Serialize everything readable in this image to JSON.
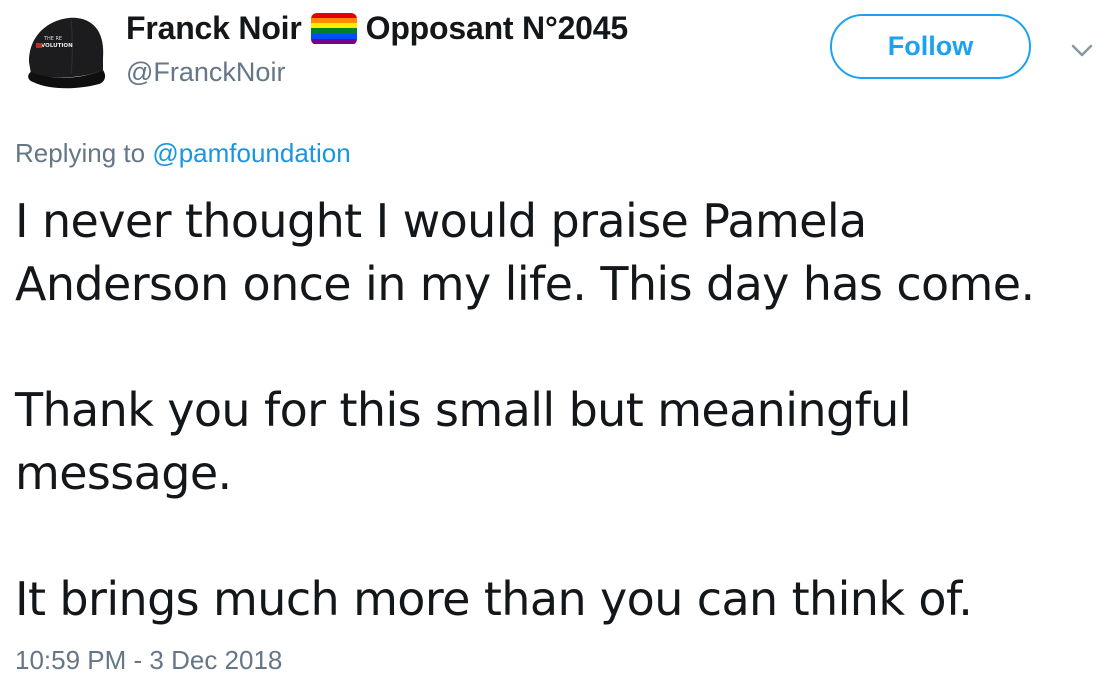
{
  "user": {
    "display_name": "Franck Noir",
    "badge_text": "Opposant N°2045",
    "handle": "@FranckNoir",
    "avatar_cap_text_line1": "THE REVOLUTION",
    "avatar_cap_text_line2": "REVOLUTION"
  },
  "follow": {
    "label": "Follow"
  },
  "reply": {
    "prefix": "Replying to ",
    "target": "@pamfoundation"
  },
  "tweet": {
    "line1": "I never thought I would praise Pamela",
    "line2": "Anderson once in my life. This day has come.",
    "line3": "Thank you for this small but meaningful",
    "line4": "message.",
    "line5": "It brings much more than you can think of."
  },
  "timestamp": "10:59 PM - 3 Dec 2018",
  "colors": {
    "accent": "#1da1f2",
    "text": "#14171a",
    "secondary": "#657786",
    "rainbow": [
      "#e40303",
      "#ff8c00",
      "#ffed00",
      "#008026",
      "#004dff",
      "#750787"
    ]
  },
  "icons": {
    "flag": "rainbow-flag-icon",
    "menu": "chevron-down-icon"
  }
}
